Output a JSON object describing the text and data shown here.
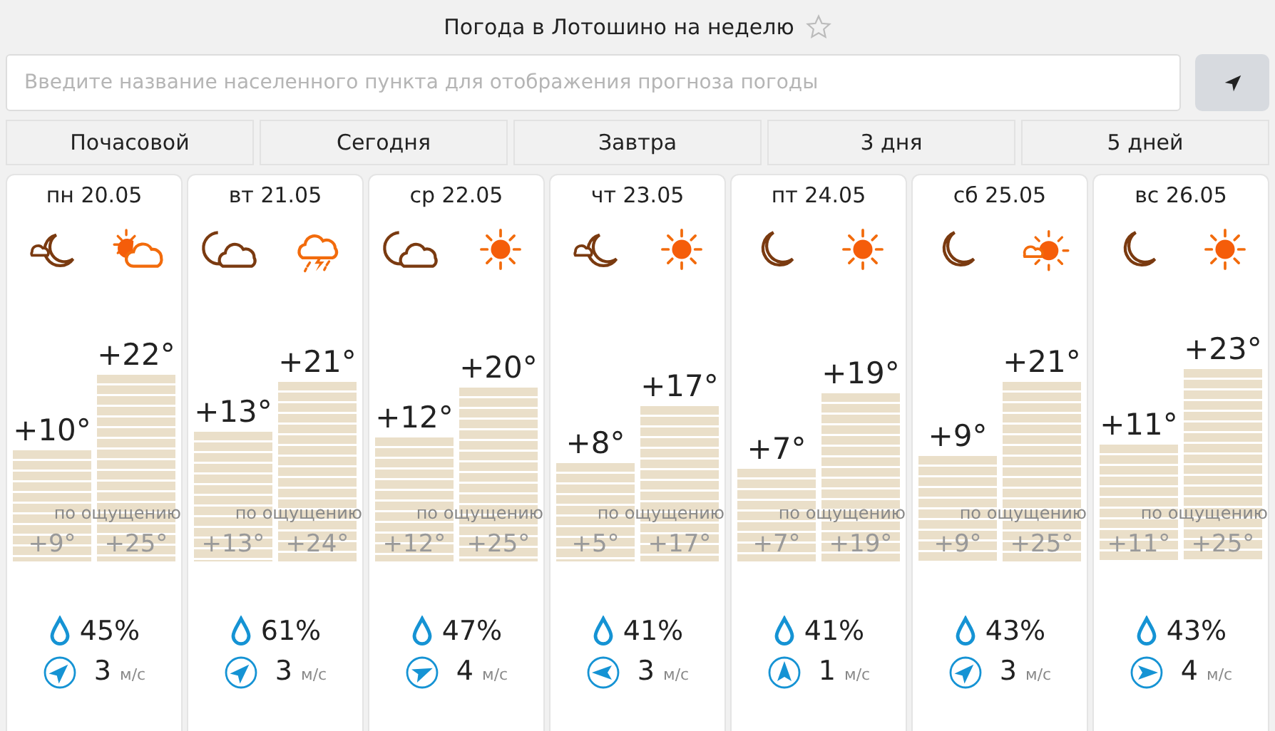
{
  "title": "Погода в Лотошино на неделю",
  "favorite": false,
  "search": {
    "placeholder": "Введите название населенного пункта для отображения прогноза погоды"
  },
  "tabs": [
    {
      "label": "Почасовой",
      "selected": false
    },
    {
      "label": "Сегодня",
      "selected": false
    },
    {
      "label": "Завтра",
      "selected": false
    },
    {
      "label": "3 дня",
      "selected": false
    },
    {
      "label": "5 дней",
      "selected": false
    }
  ],
  "days": [
    {
      "date": "пн 20.05",
      "icons": [
        {
          "kind": "night-partly"
        },
        {
          "kind": "day-partly"
        }
      ],
      "temps": [
        {
          "value": "+10°",
          "feels": "+9°"
        },
        {
          "value": "+22°",
          "feels": "+25°"
        }
      ],
      "feels_label": "по ощущению",
      "precip": "45%",
      "wind": {
        "kind": "ne",
        "speed": "3",
        "unit": "м/с"
      }
    },
    {
      "date": "вт 21.05",
      "icons": [
        {
          "kind": "night-cloudy"
        },
        {
          "kind": "thunder"
        }
      ],
      "temps": [
        {
          "value": "+13°",
          "feels": "+13°"
        },
        {
          "value": "+21°",
          "feels": "+24°"
        }
      ],
      "feels_label": "по ощущению",
      "precip": "61%",
      "wind": {
        "kind": "ne",
        "speed": "3",
        "unit": "м/с"
      }
    },
    {
      "date": "ср 22.05",
      "icons": [
        {
          "kind": "night-cloudy"
        },
        {
          "kind": "sunny"
        }
      ],
      "temps": [
        {
          "value": "+12°",
          "feels": "+12°"
        },
        {
          "value": "+20°",
          "feels": "+25°"
        }
      ],
      "feels_label": "по ощущению",
      "precip": "47%",
      "wind": {
        "kind": "ene",
        "speed": "4",
        "unit": "м/с"
      }
    },
    {
      "date": "чт 23.05",
      "icons": [
        {
          "kind": "night-partly"
        },
        {
          "kind": "sunny"
        }
      ],
      "temps": [
        {
          "value": "+8°",
          "feels": "+5°"
        },
        {
          "value": "+17°",
          "feels": "+17°"
        }
      ],
      "feels_label": "по ощущению",
      "precip": "41%",
      "wind": {
        "kind": "w",
        "speed": "3",
        "unit": "м/с"
      }
    },
    {
      "date": "пт 24.05",
      "icons": [
        {
          "kind": "night-clear"
        },
        {
          "kind": "sunny"
        }
      ],
      "temps": [
        {
          "value": "+7°",
          "feels": "+7°"
        },
        {
          "value": "+19°",
          "feels": "+19°"
        }
      ],
      "feels_label": "по ощущению",
      "precip": "41%",
      "wind": {
        "kind": "n",
        "speed": "1",
        "unit": "м/с"
      }
    },
    {
      "date": "сб 25.05",
      "icons": [
        {
          "kind": "night-clear"
        },
        {
          "kind": "day-partly-small"
        }
      ],
      "temps": [
        {
          "value": "+9°",
          "feels": "+9°"
        },
        {
          "value": "+21°",
          "feels": "+25°"
        }
      ],
      "feels_label": "по ощущению",
      "precip": "43%",
      "wind": {
        "kind": "ne",
        "speed": "3",
        "unit": "м/с"
      }
    },
    {
      "date": "вс 26.05",
      "icons": [
        {
          "kind": "night-clear"
        },
        {
          "kind": "sunny"
        }
      ],
      "temps": [
        {
          "value": "+11°",
          "feels": "+11°"
        },
        {
          "value": "+23°",
          "feels": "+25°"
        }
      ],
      "feels_label": "по ощущению",
      "precip": "43%",
      "wind": {
        "kind": "e",
        "speed": "4",
        "unit": "м/с"
      }
    }
  ]
}
